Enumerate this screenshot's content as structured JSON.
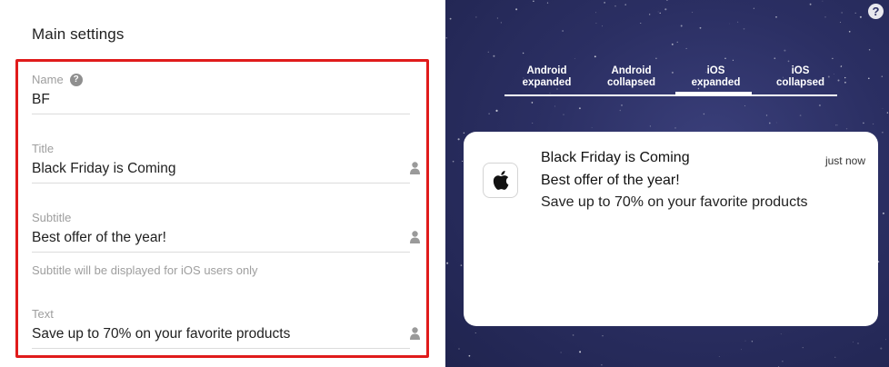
{
  "main_settings": {
    "title": "Main settings",
    "name": {
      "label": "Name",
      "value": "BF",
      "help_icon": "help-icon"
    },
    "title_field": {
      "label": "Title",
      "value": "Black Friday is Coming",
      "icon": "person-icon"
    },
    "subtitle_field": {
      "label": "Subtitle",
      "value": "Best offer of the year!",
      "icon": "person-icon",
      "hint": "Subtitle will be displayed for iOS users only"
    },
    "text_field": {
      "label": "Text",
      "value": "Save up to 70% on your favorite products",
      "icon": "person-icon"
    },
    "highlight_color": "#e01b1b"
  },
  "preview": {
    "help_icon": "?",
    "tabs": [
      {
        "line1": "Android",
        "line2": "expanded",
        "active": false
      },
      {
        "line1": "Android",
        "line2": "collapsed",
        "active": false
      },
      {
        "line1": "iOS",
        "line2": "expanded",
        "active": true
      },
      {
        "line1": "iOS",
        "line2": "collapsed",
        "active": false
      }
    ],
    "notification": {
      "app_icon": "apple-icon",
      "title": "Black Friday is Coming",
      "subtitle": "Best offer of the year!",
      "text": "Save up to 70% on your favorite products",
      "time": "just now"
    },
    "background_color": "#2b2f63"
  }
}
